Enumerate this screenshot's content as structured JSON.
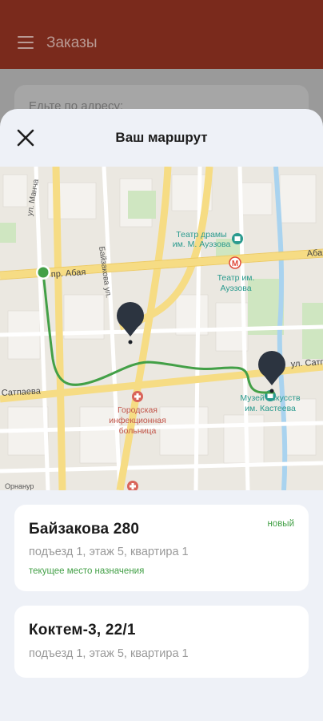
{
  "appbar": {
    "title": "Заказы"
  },
  "under": {
    "search_text": "Едьте по адресу:"
  },
  "sheet": {
    "title": "Ваш маршрут"
  },
  "map": {
    "labels": {
      "street_mancha": "ул. Манча",
      "street_baizakova": "Байзакова ул.",
      "prospect_abaya": "пр. Абая",
      "abaya_right": "Абая",
      "satpaeva_left": "Сатпаева",
      "satpaeva_right": "ул. Сатп",
      "theatre_drama": "Театр драмы",
      "theatre_drama_2": "им. М. Ауэзова",
      "theatre_metro": "Театр им.",
      "theatre_metro_2": "Ауэзова",
      "museum": "Музей искусств",
      "museum_2": "им. Кастеева",
      "hospital": "Городская",
      "hospital_2": "инфекционная",
      "hospital_3": "больница",
      "bottom_left": "Орнанур"
    },
    "route_color": "#43a047",
    "pin_color": "#2c3440"
  },
  "destinations": [
    {
      "address": "Байзакова 280",
      "details": "подъезд 1, этаж 5, квартира 1",
      "status": "текущее место назначения",
      "badge": "новый"
    },
    {
      "address": "Коктем-3, 22/1",
      "details": "подъезд 1, этаж 5, квартира 1"
    }
  ]
}
